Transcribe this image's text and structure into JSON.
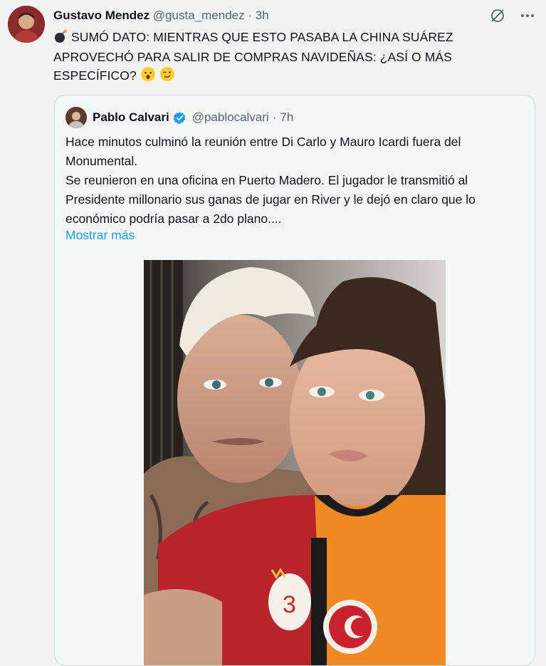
{
  "tweet": {
    "author_name": "Gustavo Mendez",
    "handle": "@gusta_mendez",
    "separator": "·",
    "time": "3h",
    "text": "SUMÓ DATO: MIENTRAS QUE ESTO PASABA LA CHINA SUÁREZ APROVECHÓ PARA SALIR DE COMPRAS NAVIDEÑAS: ¿ASÍ O MÁS ESPECÍFICO?",
    "emoji_start": "bomb-icon",
    "emoji_end": [
      "hushed-face-icon",
      "winking-face-icon"
    ]
  },
  "quote": {
    "author_name": "Pablo Calvari",
    "handle": "@pablocalvari",
    "separator": "·",
    "time": "7h",
    "paragraph1": "Hace minutos culminó la reunión entre Di Carlo y Mauro Icardi fuera del Monumental.",
    "paragraph2": "Se reunieron en una oficina en Puerto Madero. El jugador le transmitió al Presidente millonario sus ganas de jugar en River y le dejó en claro que lo económico podría pasar a 2do plano....",
    "show_more": "Mostrar más",
    "photo": "selfie-photo"
  },
  "icons": [
    "grok-icon",
    "more-options-icon"
  ],
  "colors": {
    "link": "#1d9bf0",
    "verified": "#1d9bf0",
    "muted": "#536471"
  }
}
